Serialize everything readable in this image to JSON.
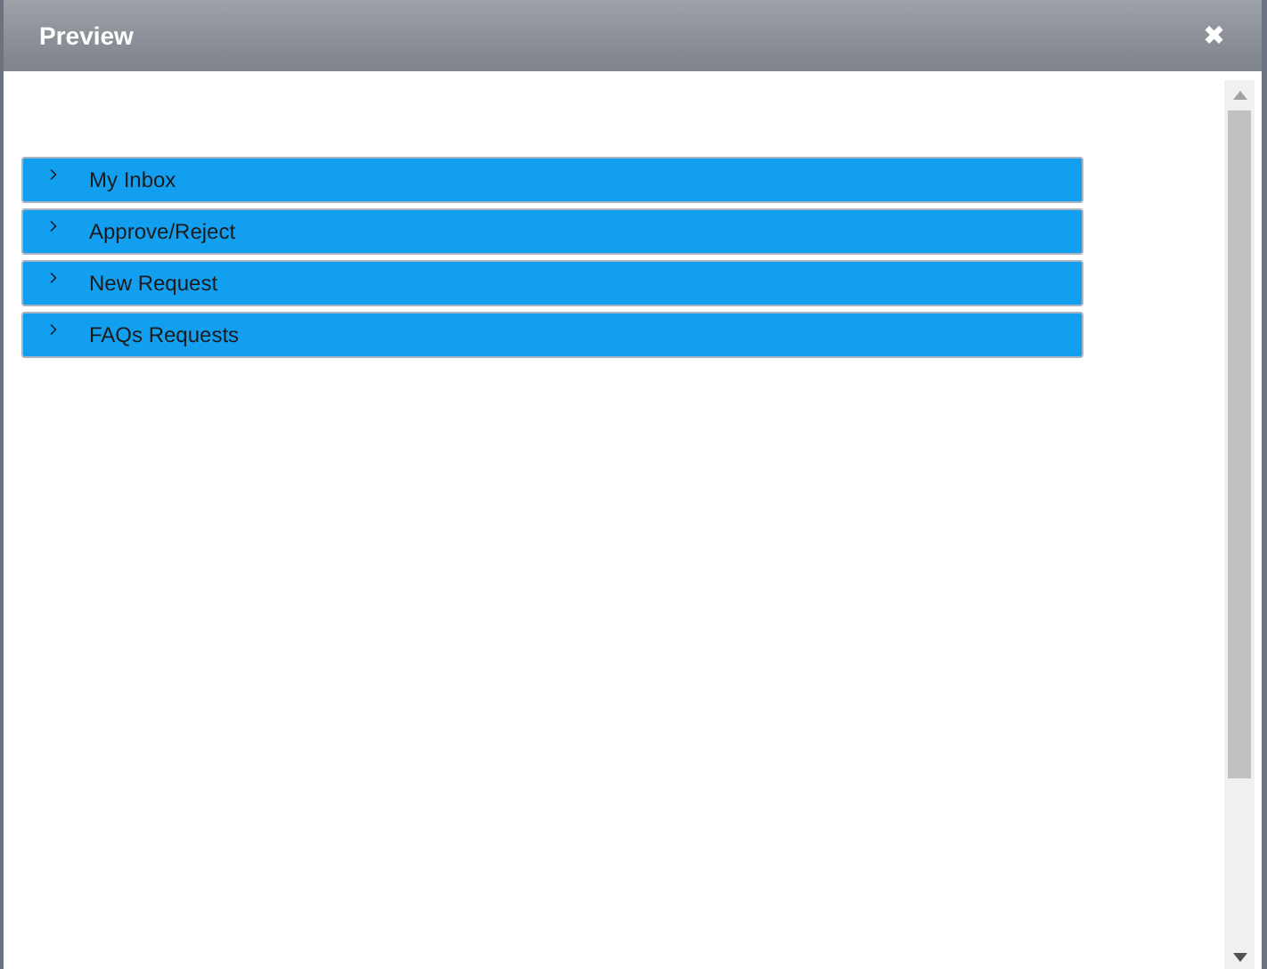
{
  "dialog": {
    "title": "Preview",
    "close": "✖"
  },
  "accordion": [
    {
      "label": "My Inbox",
      "expanded": false
    },
    {
      "label": "Approve/Reject",
      "expanded": false
    },
    {
      "label": "New Request",
      "expanded": false
    },
    {
      "label": "FAQs Requests",
      "expanded": false
    }
  ]
}
